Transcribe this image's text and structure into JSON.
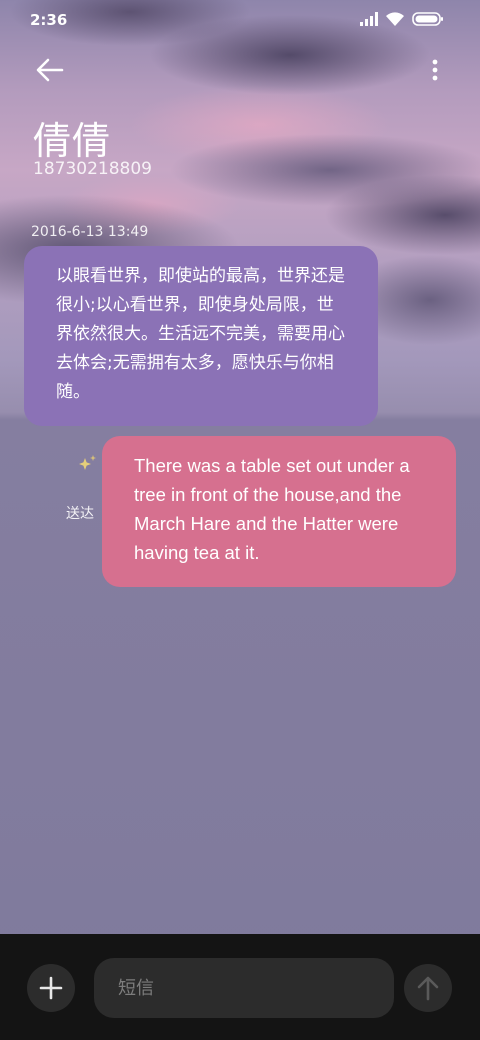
{
  "status_bar": {
    "time": "2:36",
    "icons": [
      "signal-icon",
      "wifi-icon",
      "battery-icon"
    ]
  },
  "header": {
    "back_icon": "arrow-left-icon",
    "more_icon": "more-vertical-icon",
    "contact_name": "倩倩",
    "contact_number": "18730218809"
  },
  "conversation": {
    "timestamp": "2016-6-13 13:49",
    "messages": [
      {
        "direction": "incoming",
        "text": "以眼看世界，即使站的最高，世界还是很小;以心看世界，即使身处局限，世界依然很大。生活远不完美，需要用心去体会;无需拥有太多，愿快乐与你相随。",
        "color": "#8b72b6"
      },
      {
        "direction": "outgoing",
        "text": "There was a table set out under a tree in front of the house,and the March Hare and the Hatter were having tea at it.",
        "color": "#d6708f",
        "status": "送达",
        "status_icon": "sparkle-icon"
      }
    ]
  },
  "composer": {
    "add_icon": "plus-icon",
    "placeholder": "短信",
    "send_icon": "arrow-up-icon"
  }
}
